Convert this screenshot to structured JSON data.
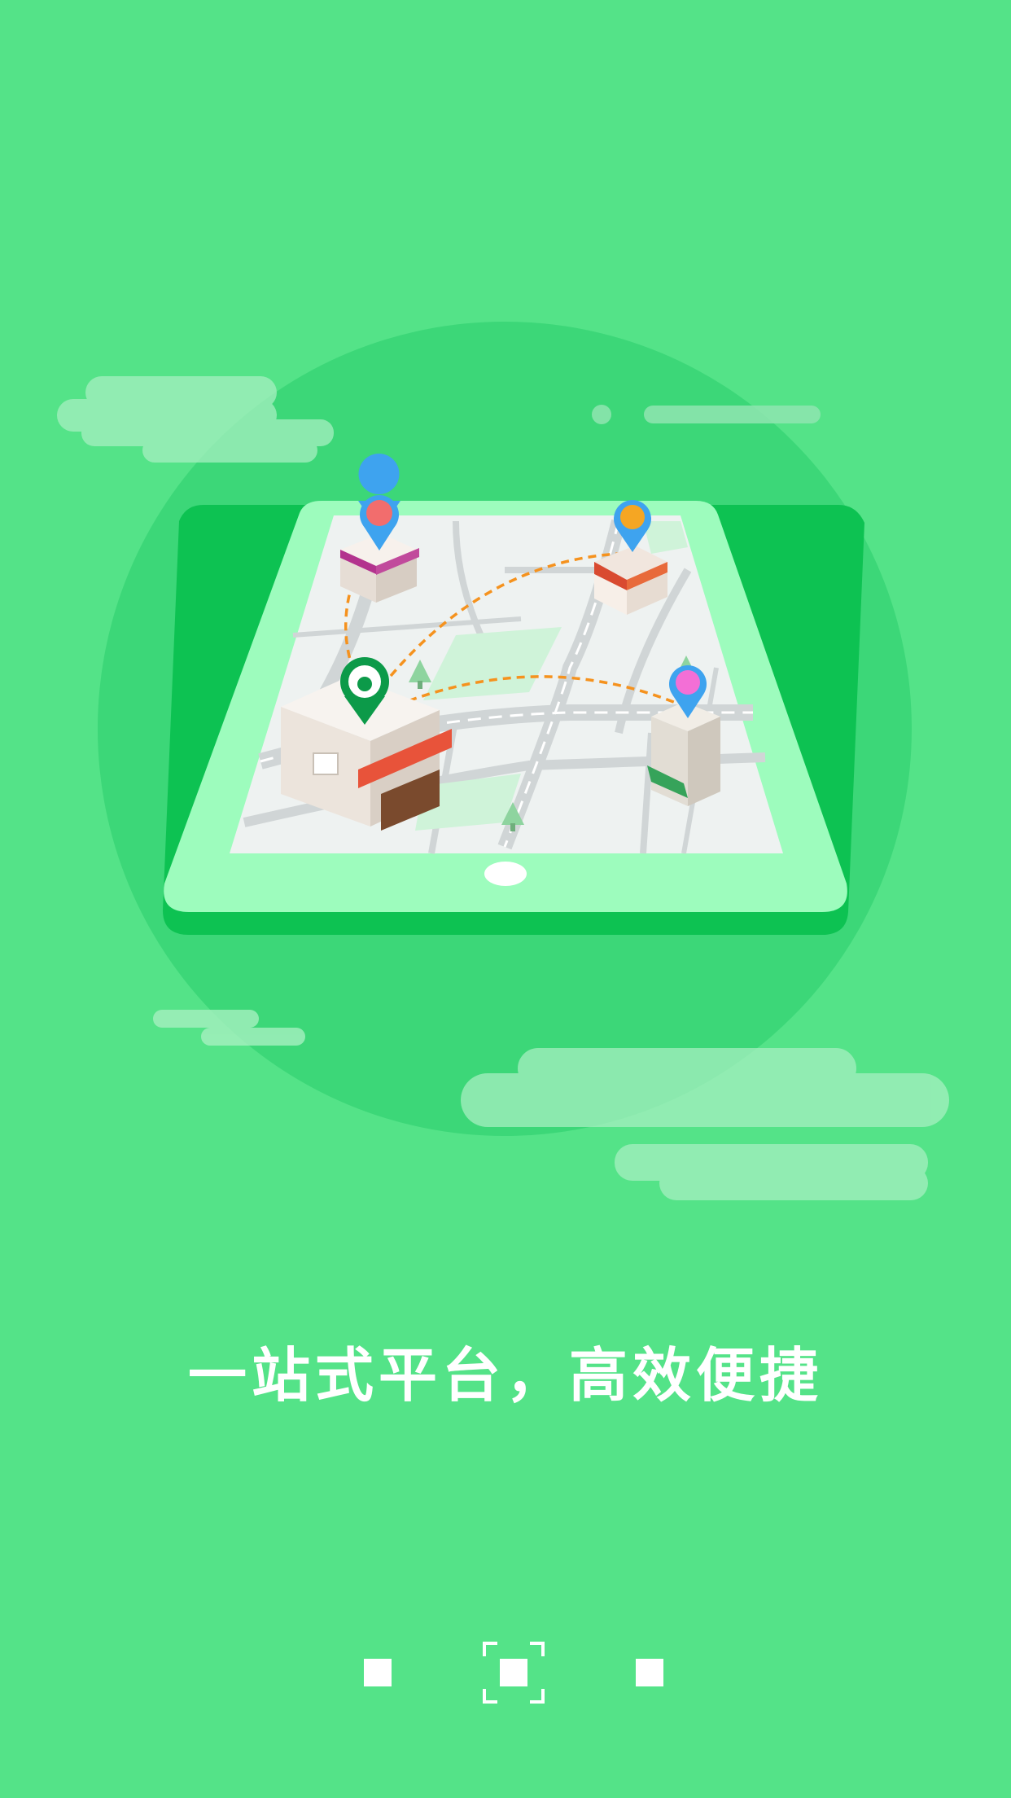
{
  "slide": {
    "slogan": "一站式平台，高效便捷",
    "illustration": "tablet-map-with-stores",
    "page_count": 3,
    "active_page": 2
  },
  "icons": {
    "pins": [
      "meat-pin-icon",
      "burger-pin-icon",
      "wine-pin-icon",
      "brand-pin-icon"
    ]
  },
  "colors": {
    "background": "#54e388",
    "circle": "#3cd778",
    "tablet_frame": "#9dfcbd",
    "tablet_edge": "#0dc252",
    "route": "#f5921e",
    "text": "#ffffff"
  }
}
